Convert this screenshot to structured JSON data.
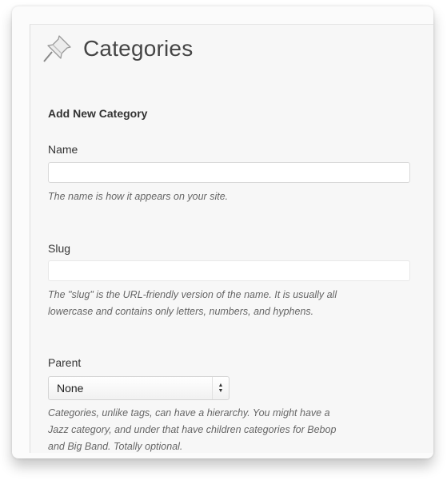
{
  "page": {
    "title": "Categories",
    "icon": "pushpin-icon"
  },
  "form": {
    "heading": "Add New Category",
    "name": {
      "label": "Name",
      "value": "",
      "help": "The name is how it appears on your site."
    },
    "slug": {
      "label": "Slug",
      "value": "",
      "help_line1": "The \"slug\" is the URL-friendly version of the name. It is usually all",
      "help_line2": "lowercase and contains only letters, numbers, and hyphens."
    },
    "parent": {
      "label": "Parent",
      "selected": "None",
      "help_line1": "Categories, unlike tags, can have a hierarchy. You might have a",
      "help_line2": "Jazz category, and under that have children categories for Bebop",
      "help_line3": "and Big Band. Totally optional."
    }
  },
  "colors": {
    "title": "#464646",
    "help_text": "#666666",
    "panel_bg": "#f7f7f7"
  }
}
